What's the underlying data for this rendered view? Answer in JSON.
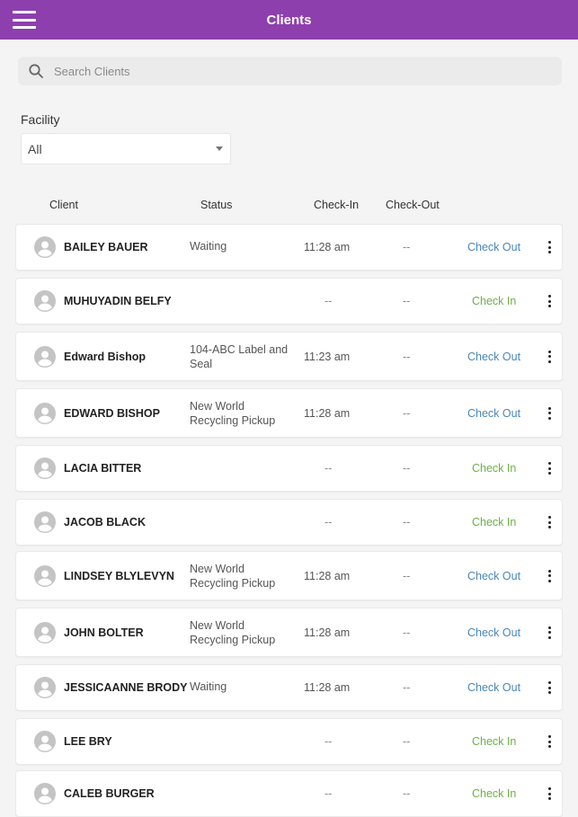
{
  "appbar": {
    "title": "Clients",
    "menu_icon": "hamburger-menu-icon"
  },
  "search": {
    "placeholder": "Search Clients",
    "value": "",
    "icon": "search-icon"
  },
  "facility": {
    "label": "Facility",
    "selected": "All"
  },
  "table": {
    "columns": {
      "client": "Client",
      "status": "Status",
      "check_in": "Check-In",
      "check_out": "Check-Out"
    },
    "rows": [
      {
        "name": "BAILEY BAUER",
        "status": "Waiting",
        "check_in": "11:28 am",
        "check_out": "--",
        "action": "Check Out"
      },
      {
        "name": "MUHUYADIN BELFY",
        "status": "",
        "check_in": "--",
        "check_out": "--",
        "action": "Check In"
      },
      {
        "name": "Edward Bishop",
        "status": "104-ABC Label and Seal",
        "check_in": "11:23 am",
        "check_out": "--",
        "action": "Check Out"
      },
      {
        "name": "EDWARD BISHOP",
        "status": "New World Recycling Pickup",
        "check_in": "11:28 am",
        "check_out": "--",
        "action": "Check Out"
      },
      {
        "name": "LACIA BITTER",
        "status": "",
        "check_in": "--",
        "check_out": "--",
        "action": "Check In"
      },
      {
        "name": "JACOB BLACK",
        "status": "",
        "check_in": "--",
        "check_out": "--",
        "action": "Check In"
      },
      {
        "name": "LINDSEY BLYLEVYN",
        "status": "New World Recycling Pickup",
        "check_in": "11:28 am",
        "check_out": "--",
        "action": "Check Out"
      },
      {
        "name": "JOHN BOLTER",
        "status": "New World Recycling Pickup",
        "check_in": "11:28 am",
        "check_out": "--",
        "action": "Check Out"
      },
      {
        "name": "JESSICAANNE BRODY",
        "status": "Waiting",
        "check_in": "11:28 am",
        "check_out": "--",
        "action": "Check Out"
      },
      {
        "name": "LEE BRY",
        "status": "",
        "check_in": "--",
        "check_out": "--",
        "action": "Check In"
      },
      {
        "name": "CALEB BURGER",
        "status": "",
        "check_in": "--",
        "check_out": "--",
        "action": "Check In"
      }
    ]
  },
  "colors": {
    "appbar": "#8e3fae",
    "check_out": "#4a86b8",
    "check_in": "#6fae4a"
  }
}
